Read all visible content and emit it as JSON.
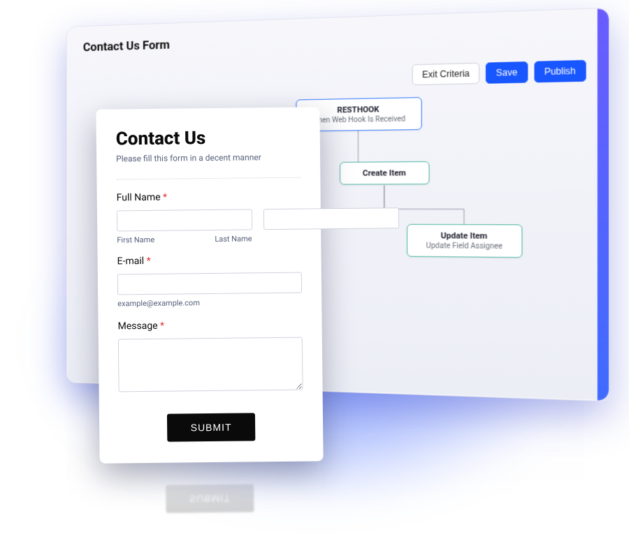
{
  "editor": {
    "title": "Contact Us Form",
    "buttons": {
      "exit_criteria": "Exit Criteria",
      "save": "Save",
      "publish": "Publish"
    },
    "flow": {
      "resthook": {
        "title": "RESTHOOK",
        "subtitle": "When Web Hook Is Received"
      },
      "createitem": {
        "title": "Create Item"
      },
      "updateitem": {
        "title": "Update Item",
        "subtitle": "Update Field Assignee"
      }
    }
  },
  "form": {
    "heading": "Contact Us",
    "subtitle": "Please fill this form in a decent manner",
    "fields": {
      "full_name": {
        "label": "Full Name",
        "first_caption": "First Name",
        "last_caption": "Last Name"
      },
      "email": {
        "label": "E-mail",
        "hint": "example@example.com"
      },
      "message": {
        "label": "Message"
      }
    },
    "submit_label": "SUBMIT",
    "required_marker": "*"
  }
}
